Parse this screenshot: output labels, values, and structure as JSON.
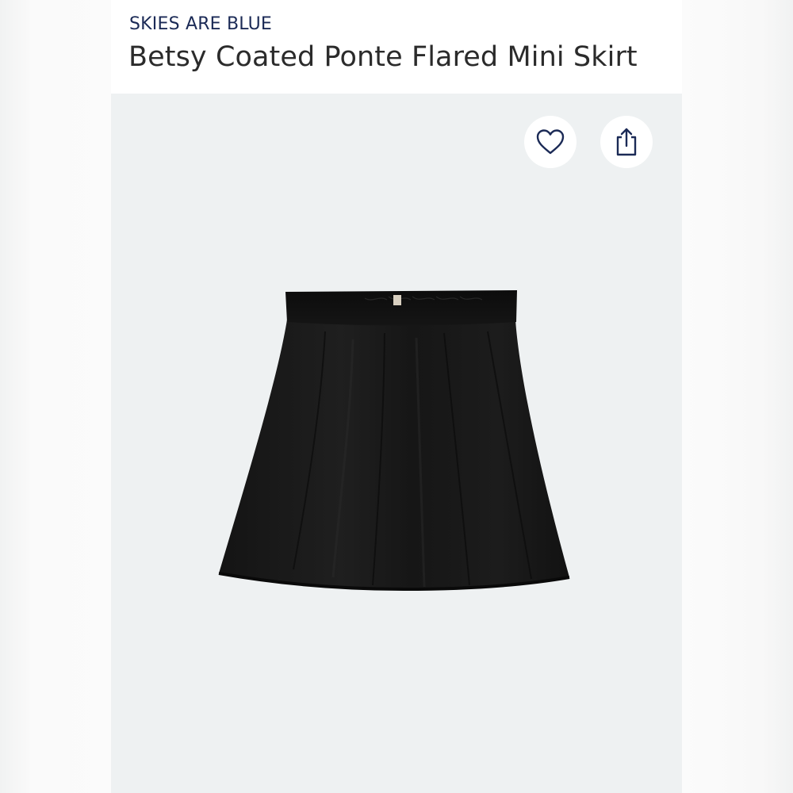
{
  "header": {
    "brand": "SKIES ARE BLUE",
    "title": "Betsy Coated Ponte Flared Mini Skirt"
  },
  "actions": {
    "favorite_icon": "heart-icon",
    "share_icon": "share-icon"
  },
  "product": {
    "image_subject": "black-mini-skirt"
  },
  "colors": {
    "brand": "#1b2a56",
    "title": "#2b2b2b",
    "image_background": "#eef1f2",
    "skirt": "#111111"
  }
}
